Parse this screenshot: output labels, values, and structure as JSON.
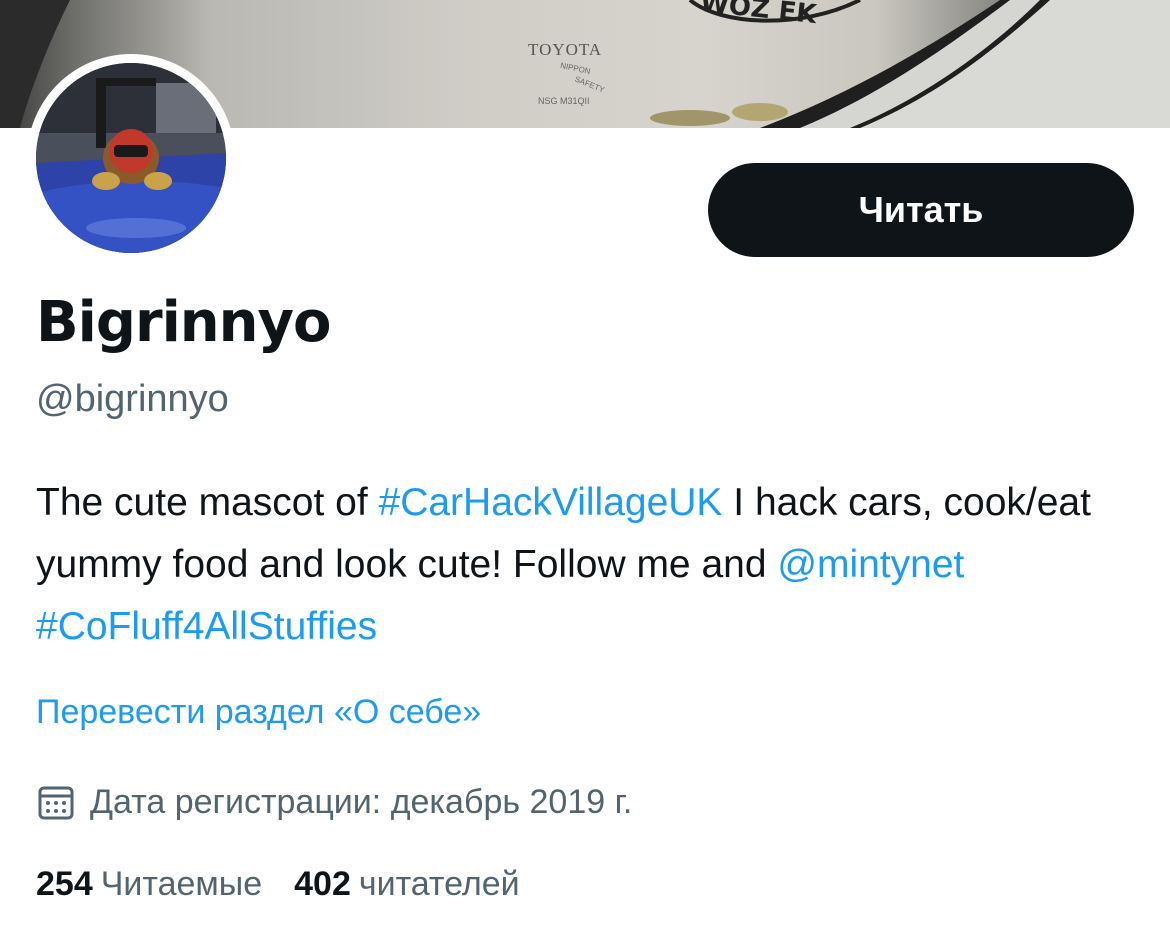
{
  "banner": {
    "glass_text_brand": "TOYOTA",
    "glass_text_a": "NIPPON",
    "glass_text_b": "SAFETY",
    "glass_text_c": "NSG M31QII",
    "sticker_text": "WOZ EK"
  },
  "profile": {
    "display_name": "Bigrinnyo",
    "handle": "@bigrinnyo",
    "follow_label": "Читать",
    "bio": {
      "part1": "The cute mascot of ",
      "hashtag1": "#CarHackVillageUK",
      "part2": " I hack cars, cook/eat yummy food and look cute! Follow me and ",
      "mention": "@mintynet",
      "part3": " ",
      "hashtag2": "#CoFluff4AllStuffies"
    },
    "translate_label": "Перевести раздел «О себе»",
    "joined_text": "Дата регистрации: декабрь 2019 г.",
    "following_count": "254",
    "following_label": "Читаемые",
    "followers_count": "402",
    "followers_label": "читателей"
  },
  "colors": {
    "link": "#1d9bf0",
    "secondary_text": "#536471",
    "primary_text": "#0f1419",
    "button_bg": "#0f1419"
  },
  "icons": {
    "joined": "calendar-icon"
  }
}
